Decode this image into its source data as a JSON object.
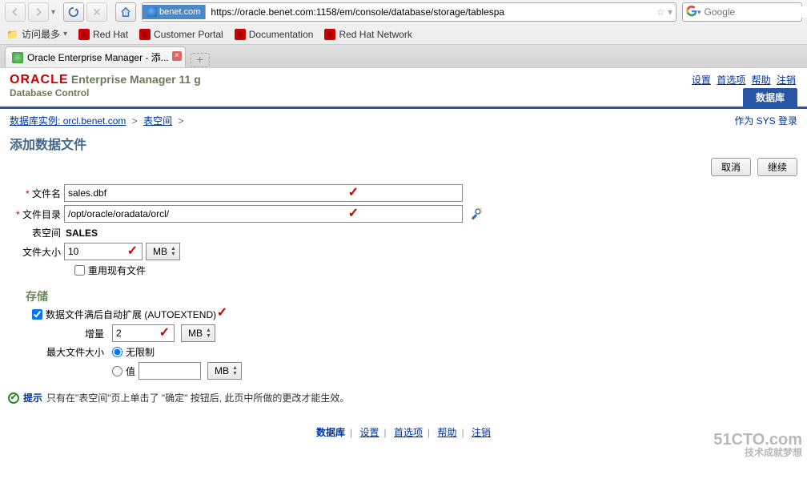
{
  "browser": {
    "url_host": "benet.com",
    "url_full": "https://oracle.benet.com:1158/em/console/database/storage/tablespa",
    "search_placeholder": "Google",
    "bookmarks": {
      "most_visited": "访问最多",
      "items": [
        "Red Hat",
        "Customer Portal",
        "Documentation",
        "Red Hat Network"
      ]
    },
    "tab_title": "Oracle Enterprise Manager - 添..."
  },
  "brand": {
    "logo": "ORACLE",
    "title": "Enterprise Manager 11 g",
    "sub": "Database Control"
  },
  "header_links": [
    "设置",
    "首选项",
    "帮助",
    "注销"
  ],
  "active_tab": "数据库",
  "breadcrumb": {
    "db_instance_label": "数据库实例:",
    "db_instance": "orcl.benet.com",
    "tablespace": "表空间",
    "login_as": "作为 SYS 登录"
  },
  "page_title": "添加数据文件",
  "buttons": {
    "cancel": "取消",
    "continue": "继续"
  },
  "form": {
    "file_name_label": "文件名",
    "file_name": "sales.dbf",
    "file_dir_label": "文件目录",
    "file_dir": "/opt/oracle/oradata/orcl/",
    "tablespace_label": "表空间",
    "tablespace_value": "SALES",
    "file_size_label": "文件大小",
    "file_size": "10",
    "unit_mb": "MB",
    "reuse_label": "重用现有文件"
  },
  "storage": {
    "section": "存储",
    "autoextend_label": "数据文件满后自动扩展 (AUTOEXTEND)",
    "increment_label": "增量",
    "increment": "2",
    "max_size_label": "最大文件大小",
    "unlimited": "无限制",
    "value_label": "值",
    "value": ""
  },
  "tip": {
    "prefix": "提示",
    "text_a": "只有在\"表空间\"页上单击了 \"确定\" 按钮后, 此页中所做的更改才能生效。"
  },
  "footer": [
    "数据库",
    "设置",
    "首选项",
    "帮助",
    "注销"
  ],
  "watermark": {
    "top": "51CTO.com",
    "bottom": "技术成就梦想"
  }
}
